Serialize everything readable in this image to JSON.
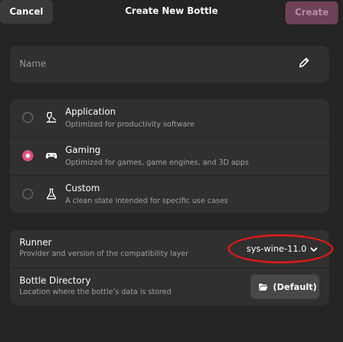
{
  "header": {
    "cancel_label": "Cancel",
    "title": "Create New Bottle",
    "create_label": "Create"
  },
  "name_field": {
    "placeholder": "Name",
    "icon": "pencil-icon"
  },
  "environments": [
    {
      "title": "Application",
      "subtitle": "Optimized for productivity software",
      "icon": "wine-glass-icon",
      "selected": false
    },
    {
      "title": "Gaming",
      "subtitle": "Optimized for games, game engines, and 3D apps",
      "icon": "gamepad-icon",
      "selected": true
    },
    {
      "title": "Custom",
      "subtitle": "A clean state intended for specific use cases",
      "icon": "flask-icon",
      "selected": false
    }
  ],
  "runner": {
    "title": "Runner",
    "subtitle": "Provider and version of the compatibility layer",
    "value": "sys-wine-11.0"
  },
  "bottle_directory": {
    "title": "Bottle Directory",
    "subtitle": "Location where the bottle’s data is stored",
    "button_label": "(Default)"
  },
  "colors": {
    "accent": "#e0537f",
    "create_button_bg": "#6f4157",
    "annotation": "#d81a1a"
  }
}
